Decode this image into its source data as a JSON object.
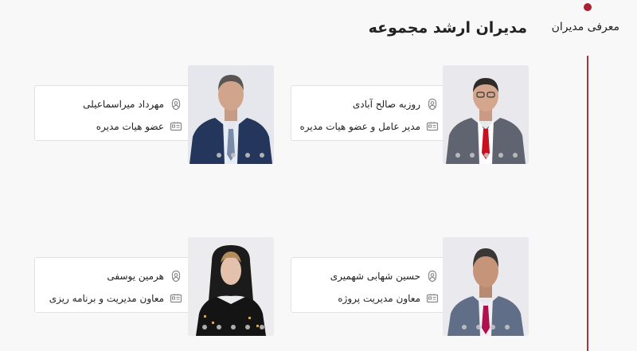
{
  "sidebar": {
    "label": "معرفی مدیران"
  },
  "header": {
    "title": "مدیران ارشد مجموعه"
  },
  "managers": [
    {
      "name": "روزبه صالح آبادی",
      "role": "مدیر عامل و عضو هیات مدیره",
      "tie_color": "#c8101f"
    },
    {
      "name": "مهرداد میراسماعیلی",
      "role": "عضو هیات مدیره",
      "tie_color": "#7b8aa8"
    },
    {
      "name": "حسین شهابی شهمیری",
      "role": "معاون مدیریت پروژه",
      "tie_color": "#b0104e"
    },
    {
      "name": "هرمین یوسفی",
      "role": "معاون مدیریت و برنامه ریزی",
      "tie_color": ""
    }
  ],
  "icons": {
    "name": "user-shield-icon",
    "role": "id-card-icon"
  },
  "colors": {
    "accent": "#a8232f",
    "card_border": "#e2e2e2",
    "background": "#f8f8f8"
  }
}
